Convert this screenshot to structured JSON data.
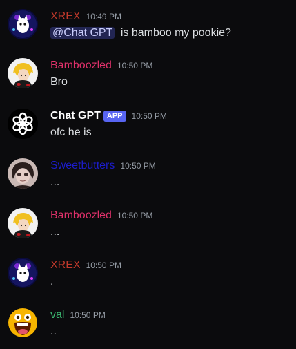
{
  "messages": [
    {
      "author": "XREX",
      "author_color": "#c0392b",
      "time": "10:49 PM",
      "mention": "@Chat GPT",
      "text": "is bamboo my pookie?",
      "avatar": "xrex-avatar"
    },
    {
      "author": "Bamboozled",
      "author_color": "#e0316a",
      "time": "10:50 PM",
      "text": "Bro",
      "avatar": "bamboozled-avatar"
    },
    {
      "author": "Chat GPT",
      "author_color": "#ffffff",
      "badge": "APP",
      "time": "10:50 PM",
      "text": "ofc he is",
      "avatar": "chatgpt-logo-avatar"
    },
    {
      "author": "Sweetbutters",
      "author_color": "#1c1cc9",
      "time": "10:50 PM",
      "text": "...",
      "avatar": "sweetbutters-avatar"
    },
    {
      "author": "Bamboozled",
      "author_color": "#e0316a",
      "time": "10:50 PM",
      "text": "...",
      "avatar": "bamboozled-avatar"
    },
    {
      "author": "XREX",
      "author_color": "#c0392b",
      "time": "10:50 PM",
      "text": ".",
      "avatar": "xrex-avatar"
    },
    {
      "author": "val",
      "author_color": "#3bb56f",
      "time": "10:50 PM",
      "text": "..",
      "avatar": "val-emoji-avatar"
    }
  ],
  "colors": {
    "background": "#0b0b0d",
    "text": "#dbdee1",
    "timestamp": "#949ba4",
    "mention_bg": "#5865f2",
    "badge_bg": "#5865f2"
  }
}
